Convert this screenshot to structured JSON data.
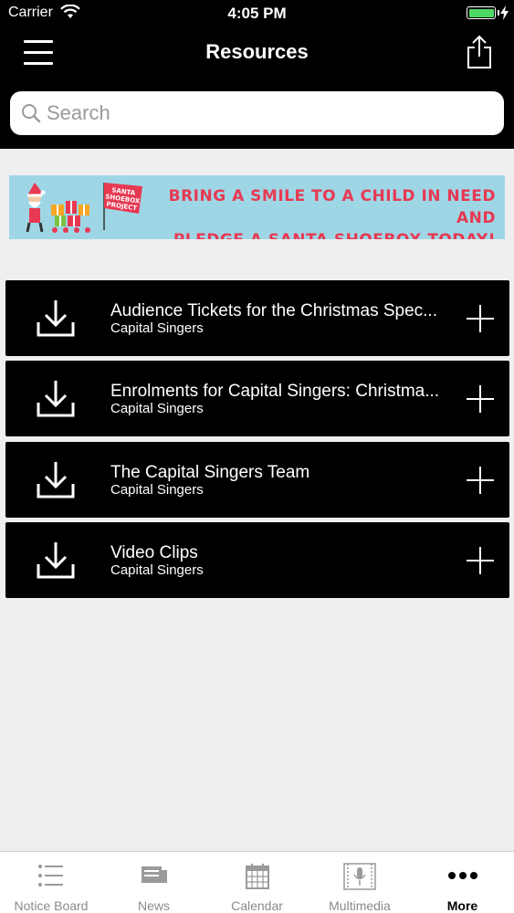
{
  "status_bar": {
    "carrier": "Carrier",
    "time": "4:05 PM"
  },
  "nav": {
    "title": "Resources"
  },
  "search": {
    "placeholder": "Search"
  },
  "banner": {
    "logo_text": "SANTA SHOEBOX PROJECT",
    "line1": "BRING A SMILE TO A CHILD IN NEED AND",
    "line2": "PLEDGE A SANTA SHOEBOX TODAY!"
  },
  "items": [
    {
      "title": "Audience Tickets for the Christmas Spec...",
      "subtitle": "Capital Singers"
    },
    {
      "title": "Enrolments for Capital Singers: Christma...",
      "subtitle": "Capital Singers"
    },
    {
      "title": "The Capital Singers Team",
      "subtitle": "Capital Singers"
    },
    {
      "title": "Video Clips",
      "subtitle": "Capital Singers"
    }
  ],
  "tabs": [
    {
      "label": "Notice Board",
      "icon": "list-icon"
    },
    {
      "label": "News",
      "icon": "newspaper-icon"
    },
    {
      "label": "Calendar",
      "icon": "calendar-icon"
    },
    {
      "label": "Multimedia",
      "icon": "microphone-icon"
    },
    {
      "label": "More",
      "icon": "more-dots-icon",
      "active": true
    }
  ],
  "colors": {
    "battery": "#4cd964",
    "banner_bg": "#9fd6e6",
    "banner_text": "#e73952"
  }
}
